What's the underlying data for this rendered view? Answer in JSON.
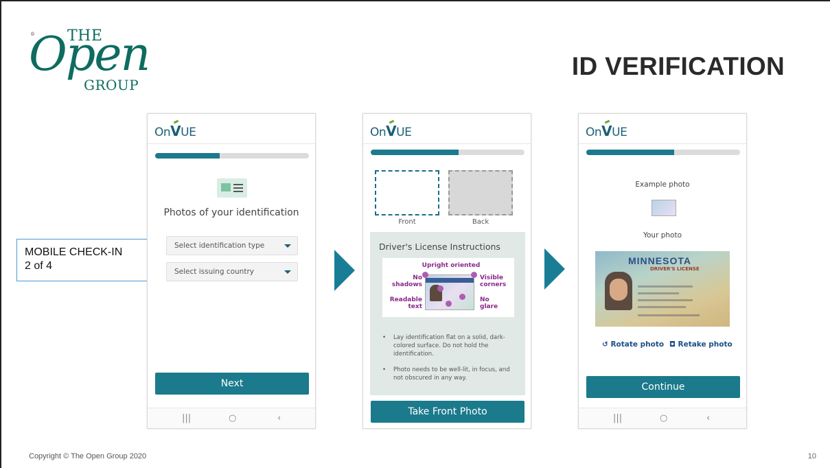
{
  "logo": {
    "reg": "®",
    "the": "THE",
    "open": "Open",
    "group": "GROUP"
  },
  "slide_title": "ID VERIFICATION",
  "side_label": {
    "line1": "MOBILE CHECK-IN",
    "line2": "2 of 4"
  },
  "footer": "Copyright © The Open Group 2020",
  "page_number": "10",
  "brand": {
    "on": "On",
    "v": "V",
    "ue": "UE"
  },
  "colors": {
    "teal": "#1b7a8c",
    "brand_blue": "#1b5f77",
    "arrow": "#1a7d96",
    "label_border": "#4a9ad6"
  },
  "nav_icons": {
    "recent": "|||",
    "home": "○",
    "back": "‹"
  },
  "screen1": {
    "progress": 0.42,
    "icon": "id-card-icon",
    "title": "Photos of your identification",
    "select_type": "Select identification type",
    "select_country": "Select issuing country",
    "next_button": "Next"
  },
  "screen2": {
    "progress": 0.57,
    "front_label": "Front",
    "back_label": "Back",
    "instructions_title": "Driver's License Instructions",
    "diagram": {
      "upright": "Upright oriented",
      "no_shadows_1": "No",
      "no_shadows_2": "shadows",
      "visible_1": "Visible",
      "visible_2": "corners",
      "readable_1": "Readable",
      "readable_2": "text",
      "no_glare_1": "No",
      "no_glare_2": "glare"
    },
    "bullet1": "Lay identification flat on a solid, dark-colored surface. Do not hold the identification.",
    "bullet2": "Photo needs to be well-lit, in focus, and not obscured in any way.",
    "take_button": "Take Front Photo"
  },
  "screen3": {
    "progress": 0.57,
    "example_label": "Example photo",
    "your_photo_label": "Your photo",
    "license_state": "MINNESOTA",
    "license_type": "DRIVER'S LICENSE",
    "rotate": "Rotate photo",
    "retake": "Retake photo",
    "continue_button": "Continue"
  }
}
